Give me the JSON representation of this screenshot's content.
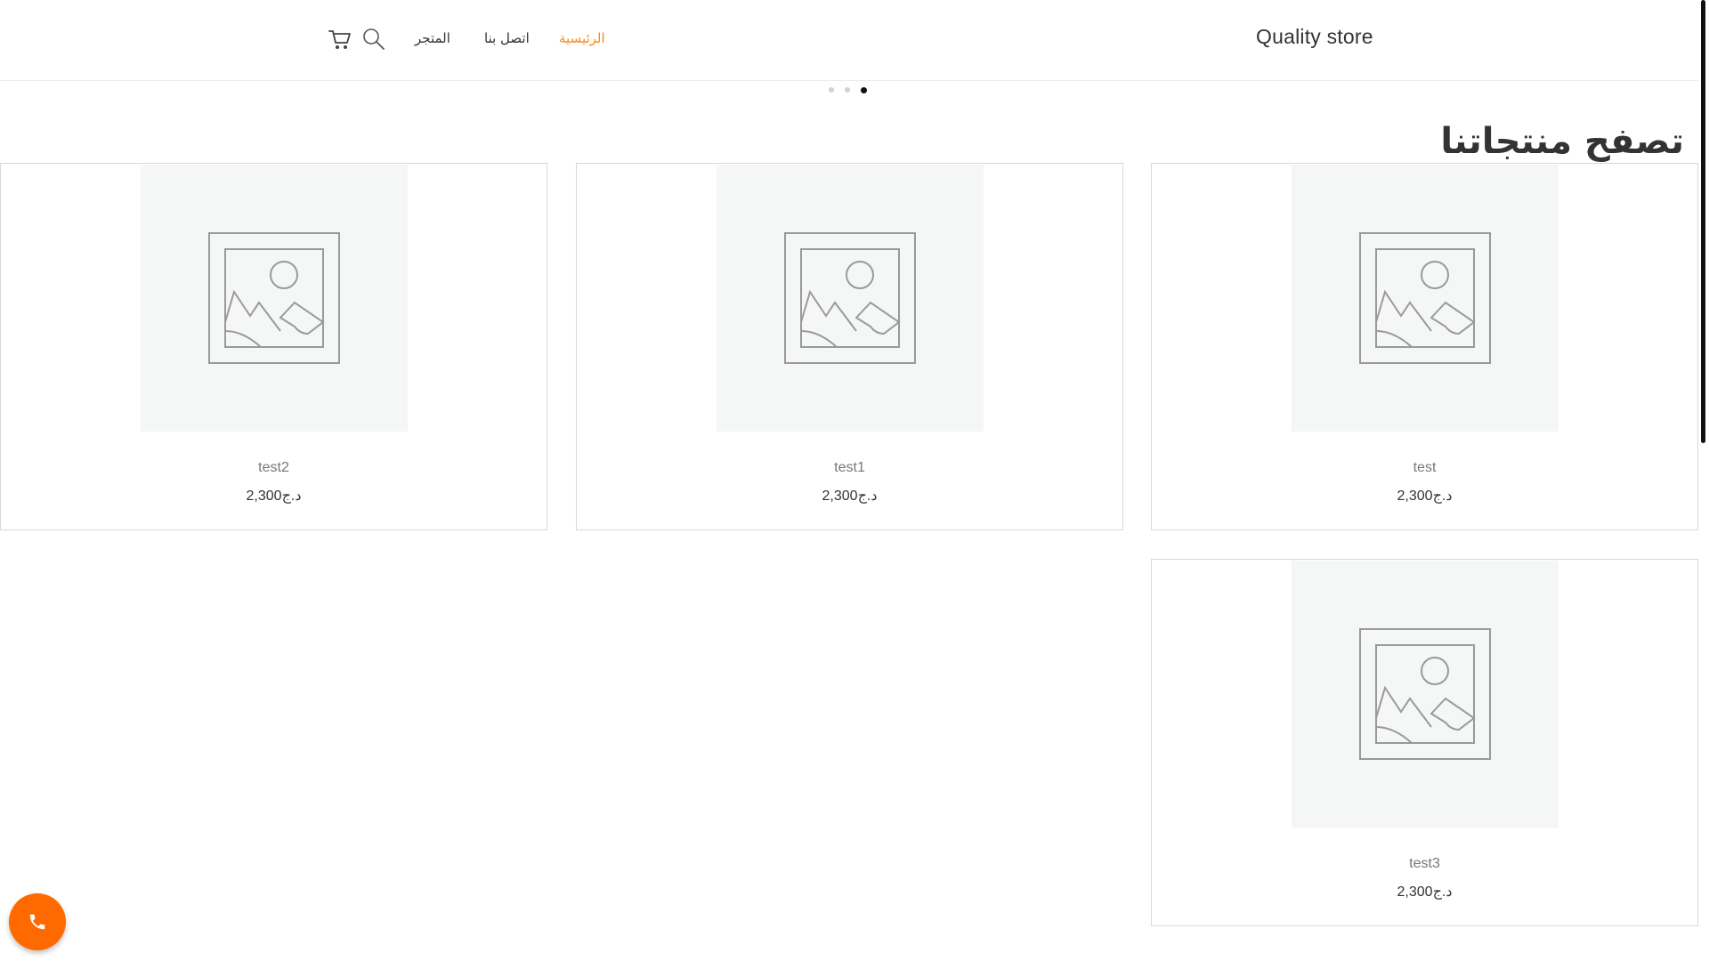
{
  "header": {
    "brand": "Quality store",
    "nav": {
      "home": "الرئيسية",
      "contact": "اتصل بنا",
      "shop": "المتجر"
    },
    "icons": {
      "search": "search-icon",
      "cart": "cart-icon"
    },
    "active_color": "#f28b1e"
  },
  "slider": {
    "dot_count": 3,
    "active_index": 2
  },
  "section": {
    "title": "تصفح منتجاتنا"
  },
  "products": [
    {
      "name": "test",
      "price": "2,300د.ج"
    },
    {
      "name": "test1",
      "price": "2,300د.ج"
    },
    {
      "name": "test2",
      "price": "2,300د.ج"
    },
    {
      "name": "test3",
      "price": "2,300د.ج"
    }
  ],
  "call_button": {
    "icon": "phone-icon",
    "color": "#ff6a00"
  }
}
